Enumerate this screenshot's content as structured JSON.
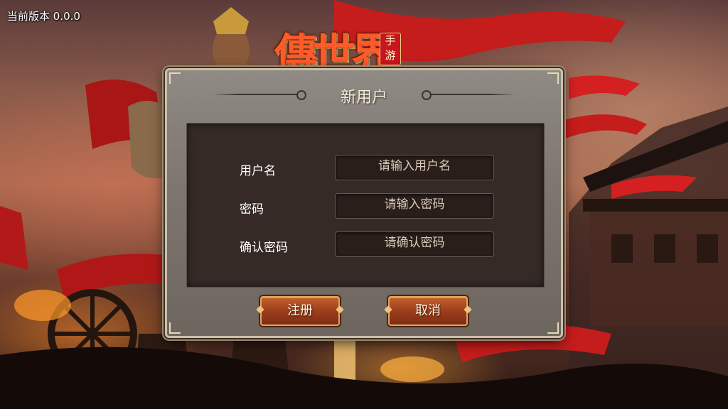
{
  "app": {
    "version_text": "当前版本 0.0.0"
  },
  "logo": {
    "text": "傳世界",
    "badge": "手游"
  },
  "dialog": {
    "title": "新用户",
    "fields": [
      {
        "label": "用户名",
        "placeholder": "请输入用户名"
      },
      {
        "label": "密码",
        "placeholder": "请输入密码"
      },
      {
        "label": "确认密码",
        "placeholder": "请确认密码"
      }
    ],
    "buttons": {
      "register_label": "注册",
      "cancel_label": "取消"
    }
  },
  "colors": {
    "accent_red": "#c8161d",
    "button_gold": "#e2a45a",
    "panel_dark": "#352a26"
  }
}
